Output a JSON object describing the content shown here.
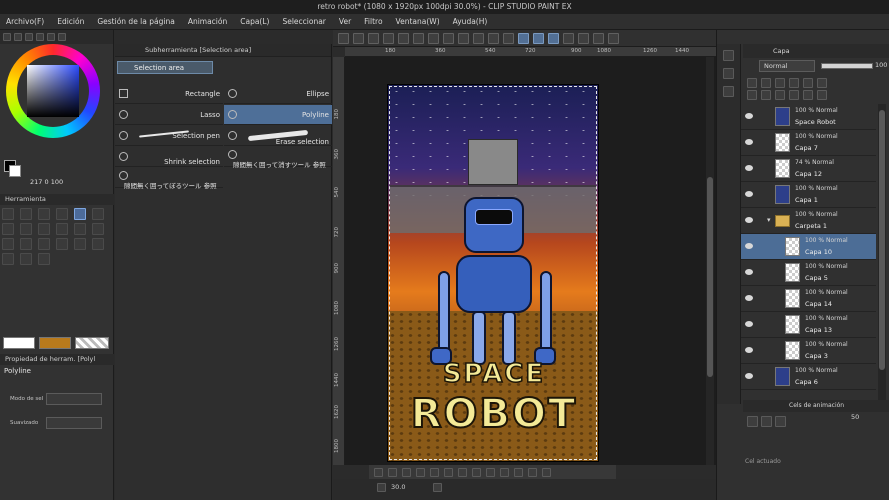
{
  "window": {
    "title": "retro robot* (1080 x 1920px 100dpi 30.0%) - CLIP STUDIO PAINT EX"
  },
  "menu": [
    "Archivo(F)",
    "Edición",
    "Gestión de la página",
    "Animación",
    "Capa(L)",
    "Seleccionar",
    "Ver",
    "Filtro",
    "Ventana(W)",
    "Ayuda(H)"
  ],
  "color_panel": {
    "h": "217",
    "s": "0",
    "v": "100",
    "fg": "#000000",
    "bg": "#ffffff"
  },
  "subtool": {
    "header": "Subherramienta [Selection area]",
    "tab": "Selection area",
    "tools": [
      {
        "label": "Rectangle",
        "selected": false
      },
      {
        "label": "Ellipse",
        "selected": false
      },
      {
        "label": "Lasso",
        "selected": false
      },
      {
        "label": "Polyline",
        "selected": true
      },
      {
        "label": "Selection pen",
        "selected": false
      },
      {
        "label": "Erase selection",
        "selected": false
      },
      {
        "label": "Shrink selection",
        "selected": false
      },
      {
        "label": "隙間無く囲って消すツール 参照",
        "selected": false
      },
      {
        "label": "隙間無く囲ってぼるツール 参照",
        "selected": false
      }
    ]
  },
  "tools_panel": {
    "header": "Herramienta"
  },
  "tool_property": {
    "header": "Propiedad de herram. [Polyl",
    "name": "Polyline",
    "row1_label": "Modo de sel",
    "row2_label": "Suavizado"
  },
  "draw_colors": {
    "main": "#ffffff",
    "sub": "#b87a1c"
  },
  "ruler": {
    "h": [
      "180",
      "360",
      "540",
      "720",
      "900",
      "1080",
      "1260",
      "1440"
    ],
    "v": [
      "180",
      "360",
      "540",
      "720",
      "900",
      "1080",
      "1260",
      "1440",
      "1620",
      "1800"
    ]
  },
  "artwork": {
    "word1": "SPACE",
    "word2": "ROBOT"
  },
  "status": {
    "zoom": "30.0"
  },
  "layer_panel": {
    "header": "Capa",
    "blend": "Normal",
    "opacity": "100",
    "layers": [
      {
        "mode": "100 % Normal",
        "name": "Space Robot",
        "indent": 0,
        "thumb": "art",
        "selected": false
      },
      {
        "mode": "100 % Normal",
        "name": "Capa 7",
        "indent": 0,
        "thumb": "blank",
        "selected": false
      },
      {
        "mode": "74 % Normal",
        "name": "Capa 12",
        "indent": 0,
        "thumb": "blank",
        "selected": false
      },
      {
        "mode": "100 % Normal",
        "name": "Capa 1",
        "indent": 0,
        "thumb": "art",
        "selected": false
      },
      {
        "mode": "100 % Normal",
        "name": "Carpeta 1",
        "indent": 0,
        "thumb": "folder",
        "selected": false
      },
      {
        "mode": "100 % Normal",
        "name": "Capa 10",
        "indent": 1,
        "thumb": "blank",
        "selected": true
      },
      {
        "mode": "100 % Normal",
        "name": "Capa 5",
        "indent": 1,
        "thumb": "blank",
        "selected": false
      },
      {
        "mode": "100 % Normal",
        "name": "Capa 14",
        "indent": 1,
        "thumb": "blank",
        "selected": false
      },
      {
        "mode": "100 % Normal",
        "name": "Capa 13",
        "indent": 1,
        "thumb": "blank",
        "selected": false
      },
      {
        "mode": "100 % Normal",
        "name": "Capa 3",
        "indent": 1,
        "thumb": "blank",
        "selected": false
      },
      {
        "mode": "100 % Normal",
        "name": "Capa 6",
        "indent": 0,
        "thumb": "art",
        "selected": false
      }
    ]
  },
  "animation_panel": {
    "header": "Cels de animación",
    "value": "50",
    "footer": "Cel actuado"
  }
}
